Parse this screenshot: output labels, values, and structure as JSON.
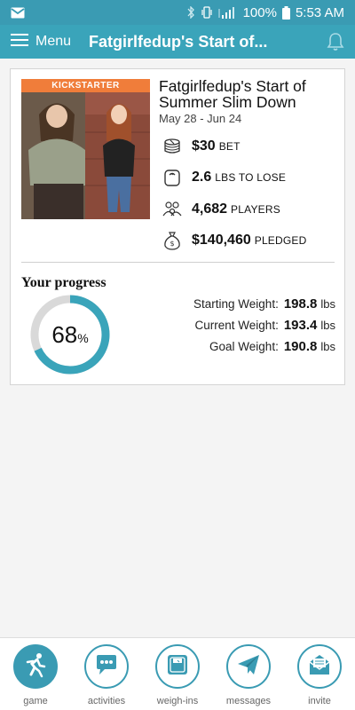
{
  "status_bar": {
    "battery": "100%",
    "time": "5:53 AM"
  },
  "app_bar": {
    "menu_label": "Menu",
    "title": "Fatgirlfedup's Start of..."
  },
  "game": {
    "badge": "KICKSTARTER",
    "title": "Fatgirlfedup's Start of Summer Slim Down",
    "dates": "May 28 - Jun 24",
    "stats": [
      {
        "icon": "coin-stack-icon",
        "value": "$30",
        "unit": "BET"
      },
      {
        "icon": "scale-icon",
        "value": "2.6",
        "unit": "LBS TO LOSE"
      },
      {
        "icon": "players-icon",
        "value": "4,682",
        "unit": "PLAYERS"
      },
      {
        "icon": "money-bag-icon",
        "value": "$140,460",
        "unit": "PLEDGED"
      }
    ]
  },
  "progress": {
    "label": "Your progress",
    "percent": 68,
    "percent_text": "68",
    "percent_symbol": "%",
    "weights": [
      {
        "label": "Starting Weight:",
        "value": "198.8",
        "unit": "lbs"
      },
      {
        "label": "Current Weight:",
        "value": "193.4",
        "unit": "lbs"
      },
      {
        "label": "Goal Weight:",
        "value": "190.8",
        "unit": "lbs"
      }
    ]
  },
  "nav": [
    {
      "label": "game",
      "icon": "runner-icon",
      "active": true
    },
    {
      "label": "activities",
      "icon": "chat-bubble-icon",
      "active": false
    },
    {
      "label": "weigh-ins",
      "icon": "scale-icon",
      "active": false
    },
    {
      "label": "messages",
      "icon": "paper-plane-icon",
      "active": false
    },
    {
      "label": "invite",
      "icon": "envelope-icon",
      "active": false
    }
  ],
  "colors": {
    "primary": "#3aa4ba",
    "ring_track": "#d9d9d9",
    "badge": "#f07d3a"
  }
}
